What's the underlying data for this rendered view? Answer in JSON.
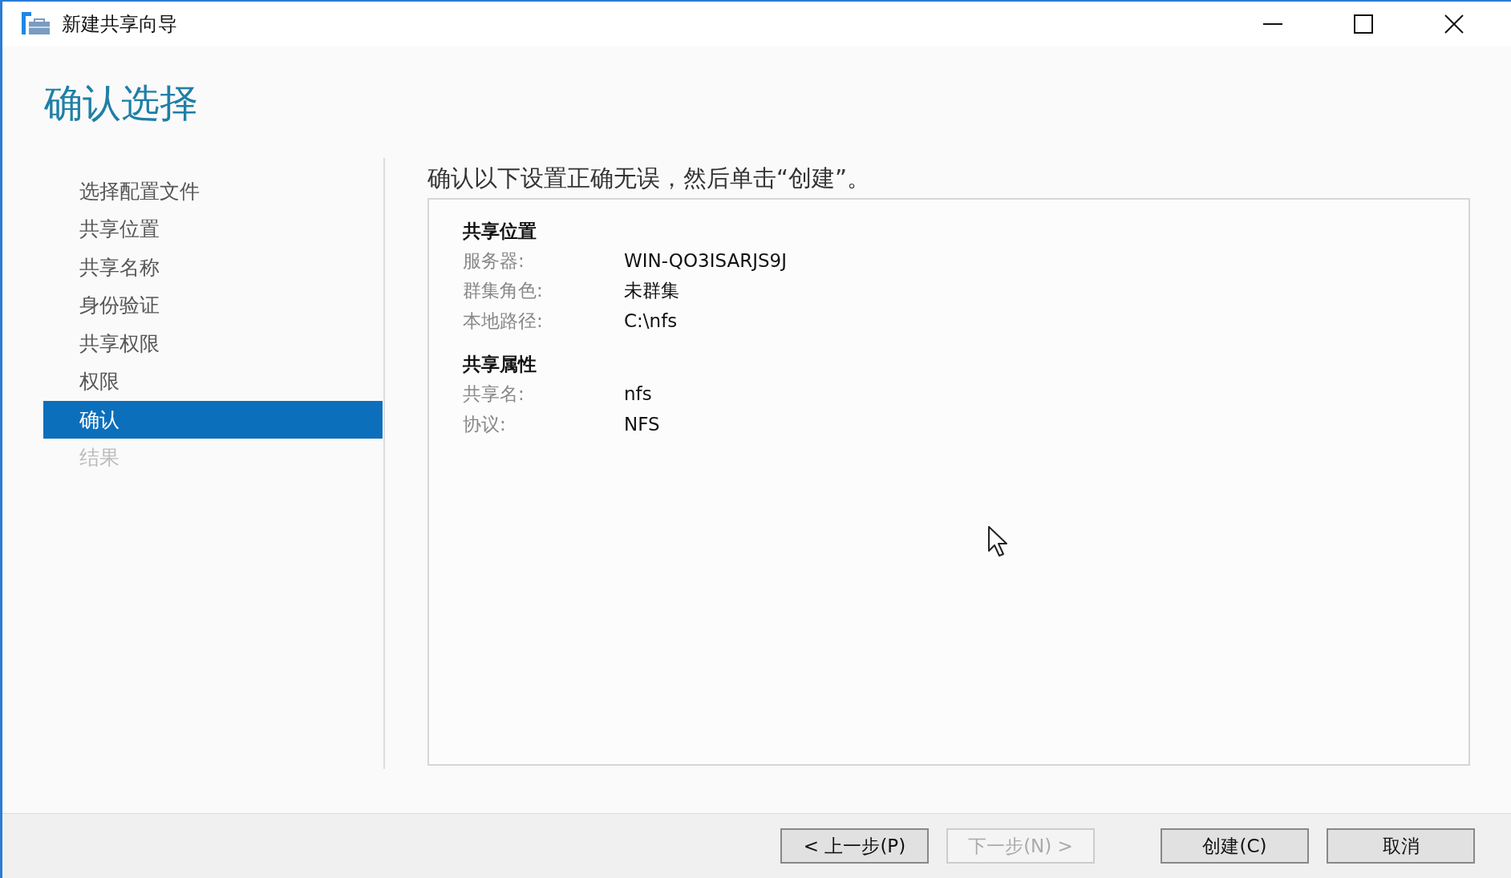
{
  "window": {
    "title": "新建共享向导"
  },
  "heading": "确认选择",
  "sidebar": {
    "items": [
      {
        "label": "选择配置文件",
        "selected": false,
        "disabled": false
      },
      {
        "label": "共享位置",
        "selected": false,
        "disabled": false
      },
      {
        "label": "共享名称",
        "selected": false,
        "disabled": false
      },
      {
        "label": "身份验证",
        "selected": false,
        "disabled": false
      },
      {
        "label": "共享权限",
        "selected": false,
        "disabled": false
      },
      {
        "label": "权限",
        "selected": false,
        "disabled": false
      },
      {
        "label": "确认",
        "selected": true,
        "disabled": false
      },
      {
        "label": "结果",
        "selected": false,
        "disabled": true
      }
    ]
  },
  "instruction": "确认以下设置正确无误，然后单击“创建”。",
  "details": {
    "groups": [
      {
        "title": "共享位置",
        "rows": [
          {
            "label": "服务器:",
            "value": "WIN-QO3ISARJS9J"
          },
          {
            "label": "群集角色:",
            "value": "未群集"
          },
          {
            "label": "本地路径:",
            "value": "C:\\nfs"
          }
        ]
      },
      {
        "title": "共享属性",
        "rows": [
          {
            "label": "共享名:",
            "value": "nfs"
          },
          {
            "label": "协议:",
            "value": "NFS"
          }
        ]
      }
    ]
  },
  "buttons": [
    {
      "label": "< 上一步(P)",
      "disabled": false
    },
    {
      "label": "下一步(N) >",
      "disabled": true
    },
    {
      "label": "创建(C)",
      "disabled": false
    },
    {
      "label": "取消",
      "disabled": false
    }
  ]
}
